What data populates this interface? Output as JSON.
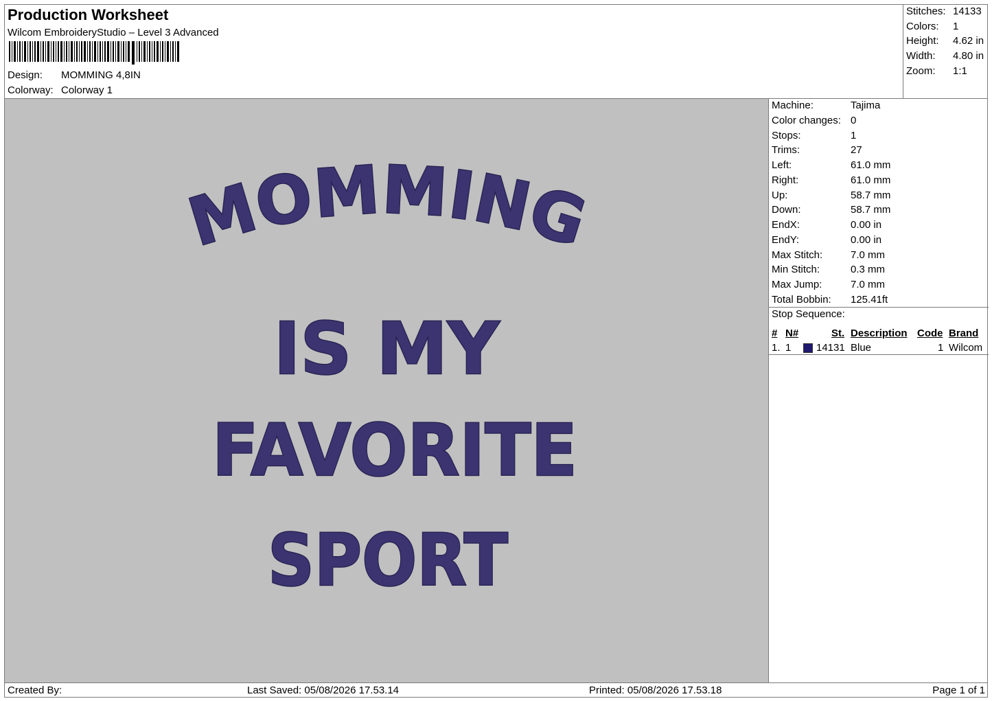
{
  "header": {
    "title": "Production Worksheet",
    "software": "Wilcom EmbroideryStudio – Level 3 Advanced",
    "design_label": "Design:",
    "design_value": "MOMMING 4,8IN",
    "colorway_label": "Colorway:",
    "colorway_value": "Colorway 1"
  },
  "summary": {
    "stitches_label": "Stitches:",
    "stitches_value": "14133",
    "colors_label": "Colors:",
    "colors_value": "1",
    "height_label": "Height:",
    "height_value": "4.62 in",
    "width_label": "Width:",
    "width_value": "4.80 in",
    "zoom_label": "Zoom:",
    "zoom_value": "1:1"
  },
  "design": {
    "lines": [
      "MOMMING",
      "IS MY",
      "FAVORITE",
      "SPORT"
    ],
    "thread_color": "#3b3470",
    "background_color": "#c0c0c0"
  },
  "machine_info": [
    {
      "label": "Machine:",
      "value": "Tajima"
    },
    {
      "label": "Color changes:",
      "value": "0"
    },
    {
      "label": "Stops:",
      "value": "1"
    },
    {
      "label": "Trims:",
      "value": "27"
    },
    {
      "label": "Left:",
      "value": "61.0 mm"
    },
    {
      "label": "Right:",
      "value": "61.0 mm"
    },
    {
      "label": "Up:",
      "value": "58.7 mm"
    },
    {
      "label": "Down:",
      "value": "58.7 mm"
    },
    {
      "label": "EndX:",
      "value": "0.00 in"
    },
    {
      "label": "EndY:",
      "value": "0.00 in"
    },
    {
      "label": "Max Stitch:",
      "value": "7.0 mm"
    },
    {
      "label": "Min Stitch:",
      "value": "0.3 mm"
    },
    {
      "label": "Max Jump:",
      "value": "7.0 mm"
    },
    {
      "label": "Total Bobbin:",
      "value": "125.41ft"
    }
  ],
  "stop_sequence": {
    "title": "Stop Sequence:",
    "columns": [
      "#",
      "N#",
      "St.",
      "Description",
      "Code",
      "Brand"
    ],
    "rows": [
      {
        "num": "1.",
        "n": "1",
        "color": "#1f1a6e",
        "st": "14131",
        "description": "Blue",
        "code": "1",
        "brand": "Wilcom"
      }
    ]
  },
  "footer": {
    "created_by": "Created By:",
    "last_saved": "Last Saved: 05/08/2026 17.53.14",
    "printed": "Printed: 05/08/2026 17.53.18",
    "page": "Page 1 of 1"
  }
}
